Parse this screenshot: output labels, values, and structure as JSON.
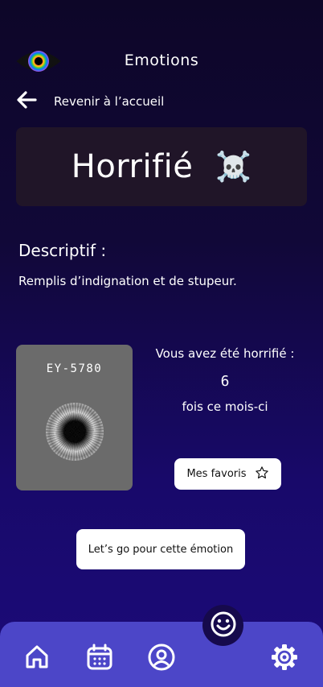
{
  "header": {
    "title": "Emotions",
    "logo_icon": "rainbow-eye-icon"
  },
  "back": {
    "label": "Revenir à l’accueil",
    "icon": "arrow-left-icon"
  },
  "emotion": {
    "name": "Horrifié",
    "emoji": "☠️"
  },
  "description": {
    "title": "Descriptif :",
    "text": "Remplis d’indignation et de stupeur."
  },
  "eye_card": {
    "code": "EY-5780",
    "image": "grey-iris"
  },
  "stats": {
    "line1": "Vous avez été horrifié :",
    "count": "6",
    "line2": "fois ce mois-ci"
  },
  "favorites_button": {
    "label": "Mes favoris",
    "icon": "star-outline-icon"
  },
  "go_button": {
    "label": "Let’s go pour cette émotion"
  },
  "nav": {
    "items": [
      {
        "icon": "home-icon"
      },
      {
        "icon": "calendar-icon"
      },
      {
        "icon": "user-circle-icon"
      },
      {
        "icon": "gear-icon"
      }
    ],
    "fab_icon": "smiley-icon"
  },
  "colors": {
    "background": "#110838",
    "card": "#201528",
    "nav": "#4c46c8",
    "fab": "#160a4c",
    "eye_card": "#6b6b6b"
  }
}
